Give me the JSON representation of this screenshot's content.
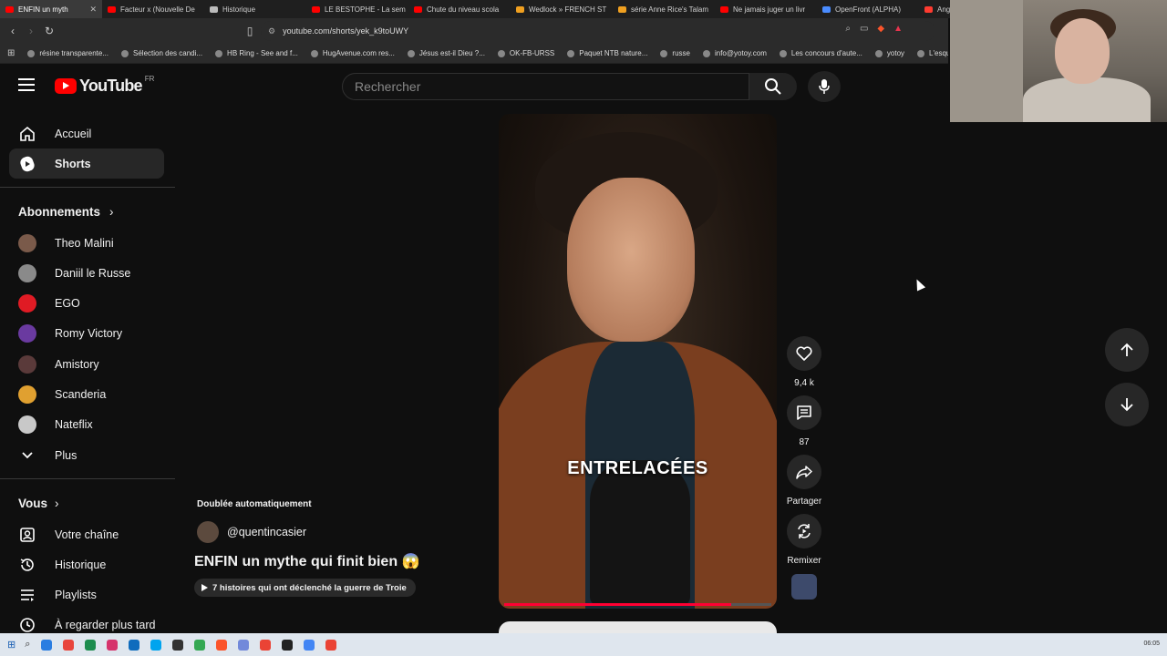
{
  "browser": {
    "tabs": [
      {
        "label": "ENFIN un myth",
        "color": "#ff0000",
        "active": true
      },
      {
        "label": "Facteur x (Nouvelle De",
        "color": "#ff0000"
      },
      {
        "label": "Historique",
        "color": "#bbbbbb"
      },
      {
        "label": "LE BESTOPHE - La sem",
        "color": "#ff0000"
      },
      {
        "label": "Chute du niveau scola",
        "color": "#ff0000"
      },
      {
        "label": "Wedlock » FRENCH ST",
        "color": "#f0a020"
      },
      {
        "label": "série Anne Rice's Talam",
        "color": "#f0a020"
      },
      {
        "label": "Ne jamais juger un livr",
        "color": "#ff0000"
      },
      {
        "label": "OpenFront (ALPHA)",
        "color": "#4a8cff"
      },
      {
        "label": "Ang",
        "color": "#ff3b30"
      }
    ],
    "url": "youtube.com/shorts/yek_k9toUWY",
    "bookmarks": [
      "résine transparente...",
      "Sélection des candi...",
      "HB Ring - See and f...",
      "HugAvenue.com res...",
      "Jésus est-il Dieu ?...",
      "OK-FB-URSS",
      "Paquet NTB nature...",
      "russe",
      "info@yotoy.com",
      "Les concours d'aute...",
      "yotoy",
      "L'esqu"
    ]
  },
  "header": {
    "logo_text": "YouTube",
    "country": "FR",
    "search_placeholder": "Rechercher"
  },
  "sidebar": {
    "main": [
      {
        "label": "Accueil",
        "icon": "home-icon"
      },
      {
        "label": "Shorts",
        "icon": "shorts-icon",
        "active": true
      }
    ],
    "subscriptions_title": "Abonnements",
    "subscriptions": [
      {
        "label": "Theo Malini",
        "color": "#7a5a4a"
      },
      {
        "label": "Daniil le Russe",
        "color": "#8a8a8a"
      },
      {
        "label": "EGO",
        "color": "#e01b24"
      },
      {
        "label": "Romy Victory",
        "color": "#6a3aa0"
      },
      {
        "label": "Amistory",
        "color": "#5a3a3a"
      },
      {
        "label": "Scanderia",
        "color": "#e0a030"
      },
      {
        "label": "Nateflix",
        "color": "#c8c8c8"
      }
    ],
    "more_label": "Plus",
    "you_title": "Vous",
    "you_items": [
      {
        "label": "Votre chaîne",
        "icon": "channel-icon"
      },
      {
        "label": "Historique",
        "icon": "history-icon"
      },
      {
        "label": "Playlists",
        "icon": "playlists-icon"
      },
      {
        "label": "À regarder plus tard",
        "icon": "watch-later-icon"
      }
    ]
  },
  "short": {
    "caption": "ENTRELACÉES",
    "progress_fraction": 0.85,
    "dubbed_label": "Doublée automatiquement",
    "channel": "@quentincasier",
    "title": "ENFIN un mythe qui finit bien 😱",
    "related_chip": "7 histoires qui ont déclenché la guerre de Troie",
    "likes": "9,4 k",
    "comments": "87",
    "share_label": "Partager",
    "remix_label": "Remixer"
  },
  "taskbar": {
    "clock": "06:05"
  }
}
